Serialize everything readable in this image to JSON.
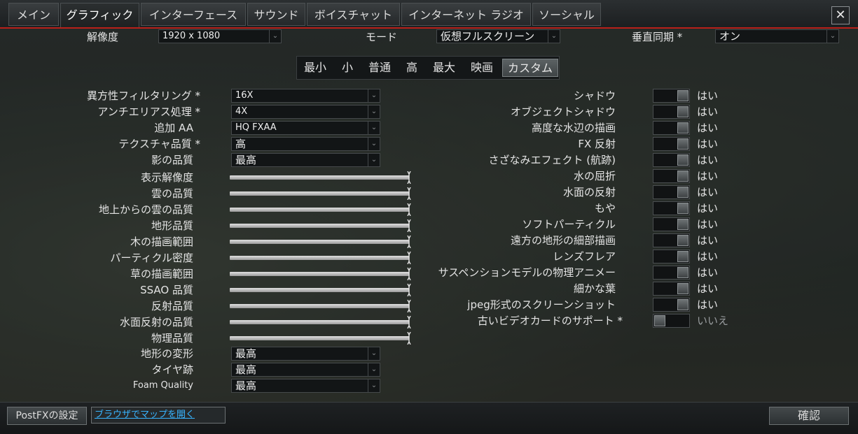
{
  "tabs": [
    {
      "id": "main",
      "label": "メイン"
    },
    {
      "id": "graphics",
      "label": "グラフィック"
    },
    {
      "id": "interface",
      "label": "インターフェース"
    },
    {
      "id": "sound",
      "label": "サウンド"
    },
    {
      "id": "voicechat",
      "label": "ボイスチャット"
    },
    {
      "id": "radio",
      "label": "インターネット ラジオ"
    },
    {
      "id": "social",
      "label": "ソーシャル"
    }
  ],
  "active_tab": "グラフィック",
  "close_label": "✕",
  "top_settings": {
    "resolution_label": "解像度",
    "resolution_value": "1920 x 1080",
    "mode_label": "モード",
    "mode_value": "仮想フルスクリーン",
    "vsync_label": "垂直同期 *",
    "vsync_value": "オン"
  },
  "presets": [
    "最小",
    "小",
    "普通",
    "高",
    "最大",
    "映画",
    "カスタム"
  ],
  "active_preset": "カスタム",
  "dropdown_settings": [
    {
      "label": "異方性フィルタリング *",
      "value": "16X"
    },
    {
      "label": "アンチエリアス処理 *",
      "value": "4X"
    },
    {
      "label": "追加 AA",
      "value": "HQ FXAA"
    },
    {
      "label": "テクスチャ品質 *",
      "value": "高"
    },
    {
      "label": "影の品質",
      "value": "最高"
    }
  ],
  "slider_settings": [
    {
      "label": "表示解像度",
      "value": 1.0
    },
    {
      "label": "雲の品質",
      "value": 1.0
    },
    {
      "label": "地上からの雲の品質",
      "value": 1.0
    },
    {
      "label": "地形品質",
      "value": 1.0
    },
    {
      "label": "木の描画範囲",
      "value": 1.0
    },
    {
      "label": "パーティクル密度",
      "value": 1.0
    },
    {
      "label": "草の描画範囲",
      "value": 1.0
    },
    {
      "label": "SSAO 品質",
      "value": 1.0
    },
    {
      "label": "反射品質",
      "value": 1.0
    },
    {
      "label": "水面反射の品質",
      "value": 1.0
    },
    {
      "label": "物理品質",
      "value": 1.0
    }
  ],
  "bottom_dropdowns": [
    {
      "label": "地形の変形",
      "value": "最高"
    },
    {
      "label": "タイヤ跡",
      "value": "最高"
    },
    {
      "label": "Foam Quality",
      "value": "最高"
    }
  ],
  "toggle_settings": [
    {
      "label": "シャドウ",
      "value": "はい",
      "on": true
    },
    {
      "label": "オブジェクトシャドウ",
      "value": "はい",
      "on": true
    },
    {
      "label": "高度な水辺の描画",
      "value": "はい",
      "on": true
    },
    {
      "label": "FX 反射",
      "value": "はい",
      "on": true
    },
    {
      "label": "さざなみエフェクト (航跡)",
      "value": "はい",
      "on": true
    },
    {
      "label": "水の屈折",
      "value": "はい",
      "on": true
    },
    {
      "label": "水面の反射",
      "value": "はい",
      "on": true
    },
    {
      "label": "もや",
      "value": "はい",
      "on": true
    },
    {
      "label": "ソフトパーティクル",
      "value": "はい",
      "on": true
    },
    {
      "label": "遠方の地形の細部描画",
      "value": "はい",
      "on": true
    },
    {
      "label": "レンズフレア",
      "value": "はい",
      "on": true
    },
    {
      "label": "サスペンションモデルの物理アニメー",
      "value": "はい",
      "on": true
    },
    {
      "label": "細かな葉",
      "value": "はい",
      "on": true
    },
    {
      "label": "jpeg形式のスクリーンショット",
      "value": "はい",
      "on": true
    },
    {
      "label": "古いビデオカードのサポート *",
      "value": "いいえ",
      "on": false
    }
  ],
  "footer": {
    "postfx_label": "PostFXの設定",
    "map_link": "ブラウザでマップを開く",
    "confirm_label": "確認"
  },
  "colors": {
    "accent_red": "#b9201a",
    "link_blue": "#38b4ff"
  }
}
